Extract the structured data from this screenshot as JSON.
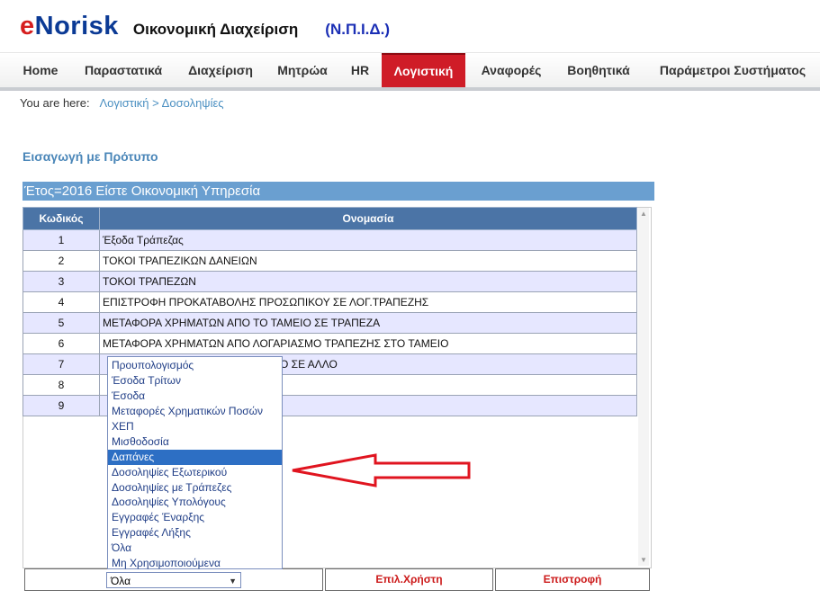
{
  "brand": {
    "logo_e": "e",
    "logo_rest": "Norisk",
    "title": "Οικονομική Διαχείριση",
    "subtitle": "(Ν.Π.Ι.Δ.)"
  },
  "nav": {
    "items": [
      "Home",
      "Παραστατικά",
      "Διαχείριση",
      "Μητρώα",
      "HR",
      "Λογιστική",
      "Αναφορές",
      "Βοηθητικά",
      "Παράμετροι Συστήματος"
    ],
    "active": "Λογιστική"
  },
  "breadcrumb": {
    "prefix": "You are here:",
    "level1": "Λογιστική",
    "separator": ">",
    "level2": "Δοσοληψίες"
  },
  "section": {
    "title": "Εισαγωγή με Πρότυπο"
  },
  "yearbar": {
    "text": "Έτος=2016 Είστε  Οικονομική Υπηρεσία"
  },
  "table": {
    "headers": {
      "code": "Κωδικός",
      "name": "Ονομασία"
    },
    "rows": [
      {
        "code": "1",
        "name": "Έξοδα Τράπεζας"
      },
      {
        "code": "2",
        "name": "ΤΟΚΟΙ ΤΡΑΠΕΖΙΚΩΝ ΔΑΝΕΙΩΝ"
      },
      {
        "code": "3",
        "name": "ΤΟΚΟΙ ΤΡΑΠΕΖΩΝ"
      },
      {
        "code": "4",
        "name": "ΕΠΙΣΤΡΟΦΗ ΠΡΟΚΑΤΑΒΟΛΗΣ ΠΡΟΣΩΠΙΚΟΥ ΣΕ ΛΟΓ.ΤΡΑΠΕΖΗΣ"
      },
      {
        "code": "5",
        "name": "ΜΕΤΑΦΟΡΑ ΧΡΗΜΑΤΩΝ ΑΠΟ ΤΟ ΤΑΜΕΙΟ ΣΕ ΤΡΑΠΕΖΑ"
      },
      {
        "code": "6",
        "name": "ΜΕΤΑΦΟΡΑ ΧΡΗΜΑΤΩΝ ΑΠΟ ΛΟΓΑΡΙΑΣΜΟ ΤΡΑΠΕΖΗΣ ΣΤΟ ΤΑΜΕΙΟ"
      },
      {
        "code": "7",
        "name": "Ο ΣΕ ΑΛΛΟ"
      },
      {
        "code": "8",
        "name": ""
      },
      {
        "code": "9",
        "name": ""
      }
    ]
  },
  "dropdown": {
    "options": [
      "Προυπολογισμός",
      "Έσοδα Τρίτων",
      "Έσοδα",
      "Μεταφορές Χρηματικών Ποσών",
      "ΧΕΠ",
      "Μισθοδοσία",
      "Δαπάνες",
      "Δοσοληψίες Εξωτερικού",
      "Δοσοληψίες με Τράπεζες",
      "Δοσοληψίες Υπολόγους",
      "Εγγραφές Έναρξης",
      "Εγγραφές Λήξης",
      "Όλα",
      "Μη Χρησιμοποιούμενα"
    ],
    "highlighted": "Δαπάνες",
    "selected_value": "Όλα"
  },
  "buttons": {
    "user_select": "Επιλ.Χρήστη",
    "back": "Επιστροφή"
  },
  "icons": {
    "dropdown_arrow": "chevron-down-icon",
    "scroll_up": "scroll-up-icon",
    "scroll_down": "scroll-down-icon",
    "annotation": "red-arrow-icon"
  },
  "colors": {
    "accent": "#cf1c27",
    "table_header": "#4b74a6",
    "year_bar": "#6a9fd0",
    "row_alt": "#e6e7ff",
    "highlight": "#2d6fc4"
  }
}
